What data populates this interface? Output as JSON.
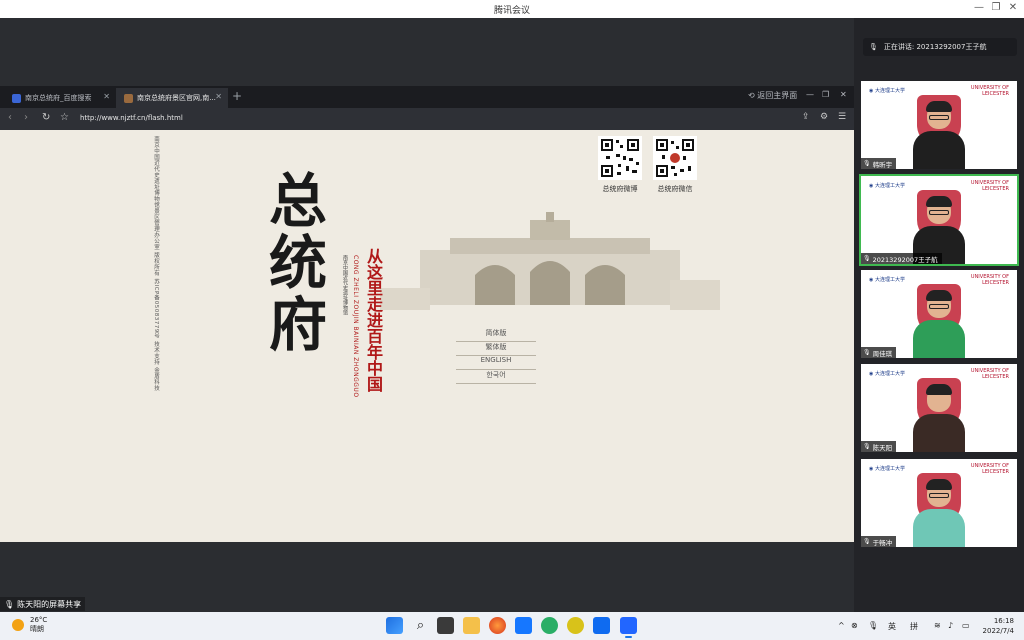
{
  "window": {
    "title": "腾讯会议",
    "controls": {
      "minimize": "—",
      "restore": "❐",
      "close": "✕"
    }
  },
  "browser": {
    "tabs": [
      {
        "label": "南京总统府_百度搜索",
        "active": false
      },
      {
        "label": "南京总统府景区官网,南...",
        "active": true
      }
    ],
    "new_tab": "+",
    "back_to_main": "返回主界面",
    "url": "http://www.njztf.cn/flash.html"
  },
  "page": {
    "side_text": "南京中国近代史遗址博物馆景区管理办公室  版权所有      苏ICP备05083779号      技术支持 金盾科技",
    "calligraphy": [
      "总",
      "统",
      "府"
    ],
    "slogan": "从这里走进百年中国",
    "pinyin": "CONG ZHELI ZOUJIN BAINIAN ZHONGGUO",
    "museum": "南京中国近代史遗址博物馆",
    "languages": [
      "简体版",
      "繁体版",
      "ENGLISH",
      "한국어"
    ],
    "qr": [
      {
        "label": "总统府微博"
      },
      {
        "label": "总统府微信"
      }
    ]
  },
  "share_label": "陈天阳的屏幕共享",
  "panel": {
    "speaking": "正在讲话: 20213292007王子航",
    "tiles": [
      {
        "name": "韩昕宇",
        "shirt": "#1f1f1f"
      },
      {
        "name": "20213292007王子航",
        "shirt": "#1f1f1f"
      },
      {
        "name": "周佳琪",
        "shirt": "#2e9e58"
      },
      {
        "name": "陈天阳",
        "shirt": "#3a2a25"
      },
      {
        "name": "于畅冲",
        "shirt": "#6fc7b6"
      }
    ],
    "logo_left": "大连理工大学",
    "logo_right_top": "UNIVERSITY OF",
    "logo_right_bottom": "LEICESTER"
  },
  "taskbar": {
    "weather_temp": "26°C",
    "weather_desc": "晴朗",
    "ime_en": "英",
    "ime_py": "拼",
    "time": "16:18",
    "date": "2022/7/4"
  },
  "colors": {
    "accent_red": "#b01818",
    "page_bg": "#efebe2",
    "active_green": "#3fb950"
  }
}
